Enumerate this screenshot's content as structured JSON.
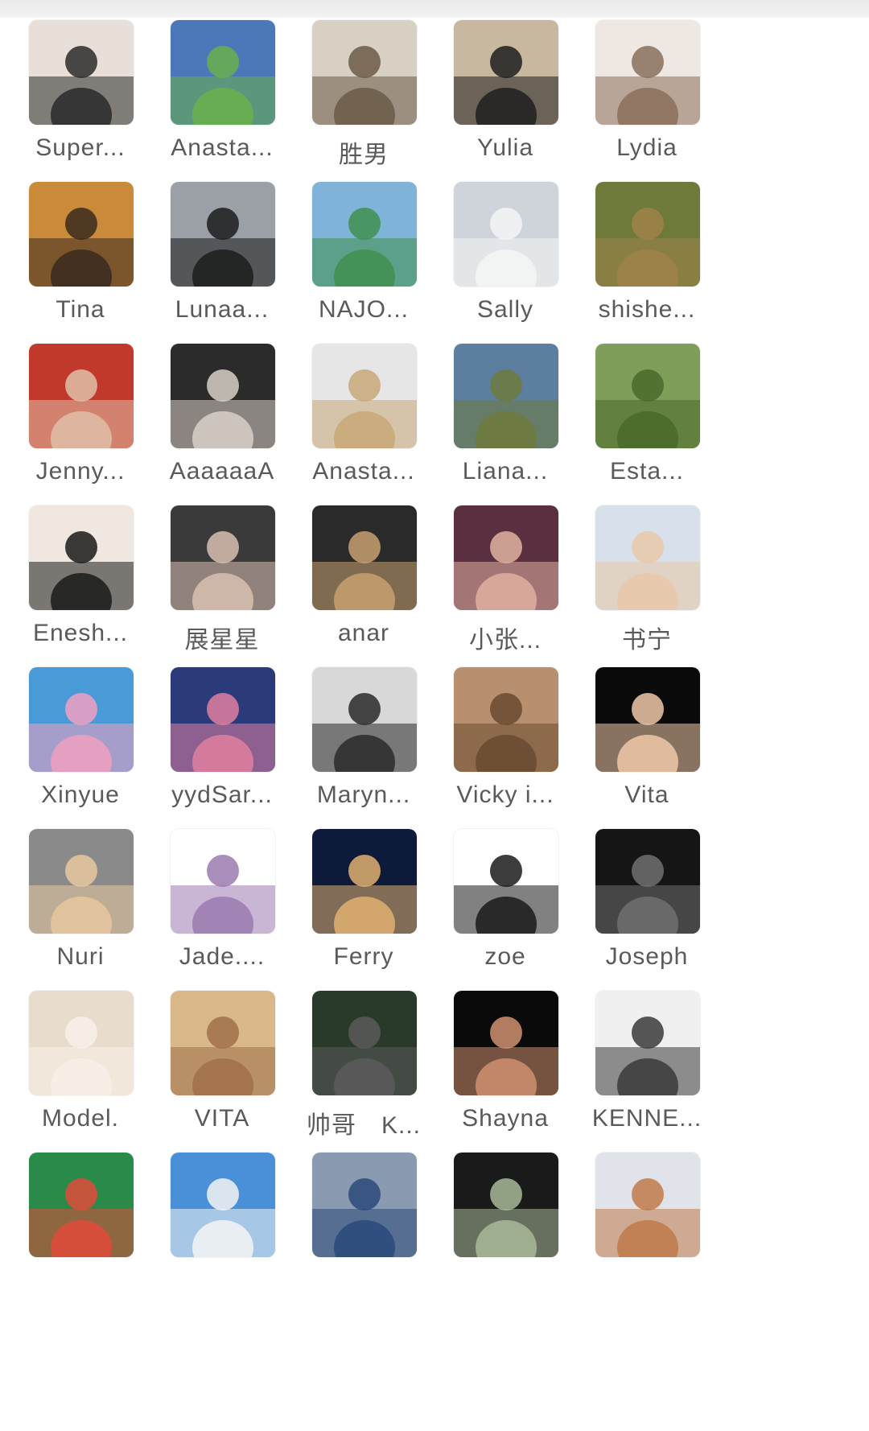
{
  "members": [
    {
      "name": "Super...",
      "avatar": "blonde-woman-avatar-icon",
      "c1": "#e8e0d8",
      "c2": "#2a2a2a"
    },
    {
      "name": "Anasta...",
      "avatar": "frog-cat-cartoon-avatar-icon",
      "c1": "#4a78b8",
      "c2": "#6ab04c"
    },
    {
      "name": "胜男",
      "avatar": "woman-at-cafe-avatar-icon",
      "c1": "#d9d0c4",
      "c2": "#6b5a48"
    },
    {
      "name": "Yulia",
      "avatar": "blonde-woman-black-top-avatar-icon",
      "c1": "#c9b8a0",
      "c2": "#1e1e1e"
    },
    {
      "name": "Lydia",
      "avatar": "woman-with-microphone-avatar-icon",
      "c1": "#efe8e2",
      "c2": "#8a6e5a"
    },
    {
      "name": "Tina",
      "avatar": "sunset-over-sea-avatar-icon",
      "c1": "#c98a3a",
      "c2": "#3a2a20"
    },
    {
      "name": "Lunaa...",
      "avatar": "dark-haired-woman-avatar-icon",
      "c1": "#9aa0a6",
      "c2": "#1c1c1c"
    },
    {
      "name": "NAJO...",
      "avatar": "woman-green-dress-palms-avatar-icon",
      "c1": "#7fb3d8",
      "c2": "#3f8f4f"
    },
    {
      "name": "Sally",
      "avatar": "woman-white-feathers-avatar-icon",
      "c1": "#cfd4da",
      "c2": "#f4f4f4"
    },
    {
      "name": "shishe...",
      "avatar": "dog-green-tiles-avatar-icon",
      "c1": "#6d7a3a",
      "c2": "#a0824a"
    },
    {
      "name": "Jenny...",
      "avatar": "woman-red-blanket-avatar-icon",
      "c1": "#c0392b",
      "c2": "#e0c0a8"
    },
    {
      "name": "AaaaaaA",
      "avatar": "woman-fur-coat-avatar-icon",
      "c1": "#2b2b2b",
      "c2": "#d8d0c8"
    },
    {
      "name": "Anasta...",
      "avatar": "long-haired-woman-avatar-icon",
      "c1": "#e6e6e6",
      "c2": "#c8a878"
    },
    {
      "name": "Liana...",
      "avatar": "coast-landscape-avatar-icon",
      "c1": "#5c7fa0",
      "c2": "#6f7a3c"
    },
    {
      "name": "Esta...",
      "avatar": "garden-swing-avatar-icon",
      "c1": "#7f9e5a",
      "c2": "#4a6a2a"
    },
    {
      "name": "Enesh...",
      "avatar": "woman-selfie-avatar-icon",
      "c1": "#f0e8e0",
      "c2": "#1a1a1a"
    },
    {
      "name": "展星星",
      "avatar": "woman-in-car-avatar-icon",
      "c1": "#3a3a3a",
      "c2": "#d8c0b0"
    },
    {
      "name": "anar",
      "avatar": "blonde-black-dress-avatar-icon",
      "c1": "#2a2a2a",
      "c2": "#c8a070"
    },
    {
      "name": "小张...",
      "avatar": "woman-city-night-avatar-icon",
      "c1": "#5a3040",
      "c2": "#e0b0a0"
    },
    {
      "name": "书宁",
      "avatar": "woman-floral-dress-avatar-icon",
      "c1": "#d8e0ec",
      "c2": "#e8c8a8"
    },
    {
      "name": "Xinyue",
      "avatar": "lotus-anime-girl-avatar-icon",
      "c1": "#4a9ad8",
      "c2": "#f0a0c0"
    },
    {
      "name": "yydSar...",
      "avatar": "woman-pink-light-avatar-icon",
      "c1": "#2a3a7a",
      "c2": "#e080a0"
    },
    {
      "name": "Maryn...",
      "avatar": "woman-on-sofa-avatar-icon",
      "c1": "#d8d8d8",
      "c2": "#2a2a2a"
    },
    {
      "name": "Vicky i...",
      "avatar": "braided-hair-woman-avatar-icon",
      "c1": "#b89070",
      "c2": "#6a4a30"
    },
    {
      "name": "Vita",
      "avatar": "memoji-girl-avatar-icon",
      "c1": "#0a0a0a",
      "c2": "#f0c8a8"
    },
    {
      "name": "Nuri",
      "avatar": "smiling-woman-selfie-avatar-icon",
      "c1": "#8a8a8a",
      "c2": "#e8c8a0"
    },
    {
      "name": "Jade....",
      "avatar": "kimono-cartoon-girl-avatar-icon",
      "c1": "#ffffff",
      "c2": "#9a7ab0"
    },
    {
      "name": "Ferry",
      "avatar": "woman-city-skyline-avatar-icon",
      "c1": "#0e1a3a",
      "c2": "#e0b070"
    },
    {
      "name": "zoe",
      "avatar": "dancing-woman-avatar-icon",
      "c1": "#ffffff",
      "c2": "#1a1a1a"
    },
    {
      "name": "Joseph",
      "avatar": "man-sunglasses-microphone-avatar-icon",
      "c1": "#151515",
      "c2": "#707070"
    },
    {
      "name": "Model.",
      "avatar": "baby-portrait-avatar-icon",
      "c1": "#e8dccc",
      "c2": "#f8f0e8"
    },
    {
      "name": "VITA",
      "avatar": "woman-straw-hat-avatar-icon",
      "c1": "#d8b888",
      "c2": "#a0704a"
    },
    {
      "name": "帅哥　K...",
      "avatar": "man-motorbike-avatar-icon",
      "c1": "#2a3a2a",
      "c2": "#5a5a5a"
    },
    {
      "name": "Shayna",
      "avatar": "woman-hand-on-face-avatar-icon",
      "c1": "#0a0a0a",
      "c2": "#d09070"
    },
    {
      "name": "KENNE...",
      "avatar": "statue-bust-avatar-icon",
      "c1": "#f0f0f0",
      "c2": "#3a3a3a"
    },
    {
      "name": "",
      "avatar": "mermaid-singer-avatar-icon",
      "c1": "#2a8a4a",
      "c2": "#e04a3a"
    },
    {
      "name": "",
      "avatar": "man-white-jacket-avatar-icon",
      "c1": "#4a90d8",
      "c2": "#f4f4f4"
    },
    {
      "name": "",
      "avatar": "sea-clouds-avatar-icon",
      "c1": "#8a9ab0",
      "c2": "#2a4a7a"
    },
    {
      "name": "",
      "avatar": "money-stack-avatar-icon",
      "c1": "#1a1a1a",
      "c2": "#a8b898"
    },
    {
      "name": "",
      "avatar": "cat-avatar-icon",
      "c1": "#e0e4ea",
      "c2": "#c07a4a"
    }
  ]
}
